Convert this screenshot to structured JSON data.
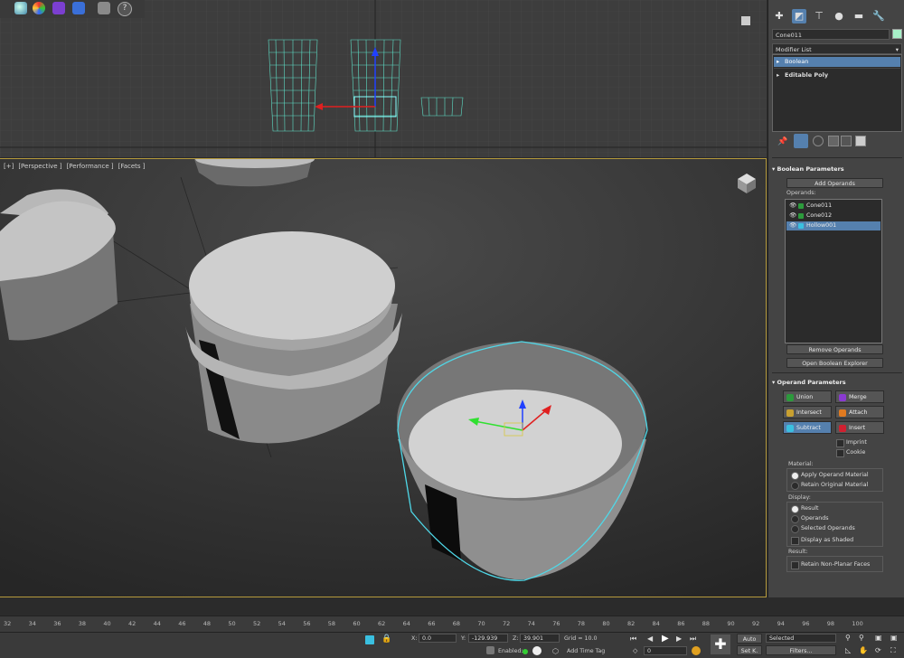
{
  "viewports": {
    "perspective": {
      "label_plus": "[+]",
      "label_view": "[Perspective ]",
      "label_perf": "[Performance ]",
      "label_shading": "[Facets ]"
    }
  },
  "command_panel": {
    "object_name": "Cone011",
    "object_color": "#a8f0c8",
    "modifier_list": "Modifier List",
    "stack": [
      "Boolean",
      "Editable Poly"
    ],
    "boolean_parameters": {
      "title": "Boolean Parameters",
      "add_operands": "Add Operands",
      "operands_label": "Operands:",
      "operands": [
        "Cone011",
        "Cone012",
        "Hollow001"
      ],
      "remove_operands": "Remove Operands",
      "open_explorer": "Open Boolean Explorer"
    },
    "operand_parameters": {
      "title": "Operand Parameters",
      "ops": [
        "Union",
        "Merge",
        "Intersect",
        "Attach",
        "Subtract",
        "Insert"
      ],
      "imprint": "Imprint",
      "cookie": "Cookie",
      "material_label": "Material:",
      "material_options": [
        "Apply Operand Material",
        "Retain Original Material"
      ],
      "display_label": "Display:",
      "display_options": [
        "Result",
        "Operands",
        "Selected Operands",
        "Display as Shaded"
      ],
      "result_label": "Result:",
      "retain_nonplanar": "Retain Non-Planar Faces"
    }
  },
  "timeline": {
    "ticks": [
      "32",
      "34",
      "36",
      "38",
      "40",
      "42",
      "44",
      "46",
      "48",
      "50",
      "52",
      "54",
      "56",
      "58",
      "60",
      "62",
      "64",
      "66",
      "68",
      "70",
      "72",
      "74",
      "76",
      "78",
      "80",
      "82",
      "84",
      "86",
      "88",
      "90",
      "92",
      "94",
      "96",
      "98",
      "100"
    ]
  },
  "status_bar": {
    "x_label": "X:",
    "x_value": "0.0",
    "y_label": "Y:",
    "y_value": "-129.939",
    "z_label": "Z:",
    "z_value": "39.901",
    "grid": "Grid = 10.0",
    "enabled": "Enabled:",
    "add_time_tag": "Add Time Tag",
    "frame": "0",
    "auto": "Auto",
    "set_key": "Set K.",
    "selected": "Selected",
    "filters": "Filters..."
  },
  "colors": {
    "accent": "#5580ae",
    "selection_cyan": "#4fd8e8",
    "viewport_border": "#b59a3c"
  }
}
